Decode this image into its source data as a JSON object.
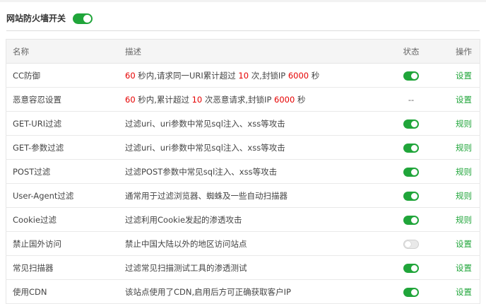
{
  "header": {
    "title": "网站防火墙开关",
    "enabled": true
  },
  "columns": {
    "name": "名称",
    "desc": "描述",
    "status": "状态",
    "op": "操作"
  },
  "rows": [
    {
      "name": "CC防御",
      "desc": [
        [
          "60",
          "red"
        ],
        [
          " 秒内,请求同一URI累计超过 ",
          ""
        ],
        [
          "10",
          "red"
        ],
        [
          " 次,封锁IP ",
          ""
        ],
        [
          "6000",
          "red"
        ],
        [
          " 秒",
          ""
        ]
      ],
      "status": "on",
      "op": "设置"
    },
    {
      "name": "恶意容忍设置",
      "desc": [
        [
          "60",
          "red"
        ],
        [
          " 秒内,累计超过 ",
          ""
        ],
        [
          "10",
          "red"
        ],
        [
          " 次恶意请求,封锁IP ",
          ""
        ],
        [
          "6000",
          "red"
        ],
        [
          " 秒",
          ""
        ]
      ],
      "status": "--",
      "op": "设置"
    },
    {
      "name": "GET-URI过滤",
      "desc": [
        [
          "过滤uri、uri参数中常见sql注入、xss等攻击",
          ""
        ]
      ],
      "status": "on",
      "op": "规则"
    },
    {
      "name": "GET-参数过滤",
      "desc": [
        [
          "过滤uri、uri参数中常见sql注入、xss等攻击",
          ""
        ]
      ],
      "status": "on",
      "op": "规则"
    },
    {
      "name": "POST过滤",
      "desc": [
        [
          "过滤POST参数中常见sql注入、xss等攻击",
          ""
        ]
      ],
      "status": "on",
      "op": "规则"
    },
    {
      "name": "User-Agent过滤",
      "desc": [
        [
          "通常用于过滤浏览器、蜘蛛及一些自动扫描器",
          ""
        ]
      ],
      "status": "on",
      "op": "规则"
    },
    {
      "name": "Cookie过滤",
      "desc": [
        [
          "过滤利用Cookie发起的渗透攻击",
          ""
        ]
      ],
      "status": "on",
      "op": "规则"
    },
    {
      "name": "禁止国外访问",
      "desc": [
        [
          "禁止中国大陆以外的地区访问站点",
          ""
        ]
      ],
      "status": "off",
      "op": "设置"
    },
    {
      "name": "常见扫描器",
      "desc": [
        [
          "过滤常见扫描测试工具的渗透测试",
          ""
        ]
      ],
      "status": "on",
      "op": "设置"
    },
    {
      "name": "使用CDN",
      "desc": [
        [
          "该站点使用了CDN,启用后方可正确获取客户IP",
          ""
        ]
      ],
      "status": "on",
      "op": "设置"
    }
  ],
  "colors": {
    "accent": "#20a53a",
    "highlight": "#e60000"
  }
}
